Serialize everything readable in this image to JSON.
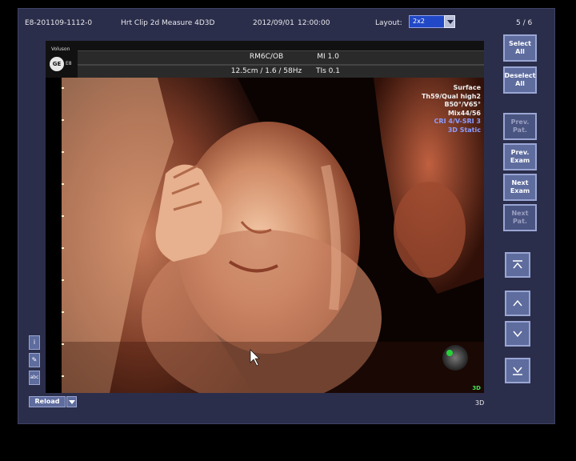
{
  "topbar": {
    "exam_id": "E8-201109-1112-0",
    "clip_title": "Hrt Clip 2d Measure 4D3D",
    "date": "2012/09/01",
    "time": "12:00:00",
    "layout_label": "Layout:",
    "layout_value": "2x2",
    "page": "5 / 6"
  },
  "viewer": {
    "brand": "Voluson",
    "model": "E8",
    "logo": "GE",
    "probe": "RM6C/OB",
    "depth_info": "12.5cm / 1.6 / 58Hz",
    "mi": "MI 1.0",
    "tis": "TIs 0.1",
    "params": [
      "Surface",
      "Th59/Qual high2",
      "B50°/V65°",
      "Mix44/56"
    ],
    "params_blue": [
      "CRI 4/V-SRI 3",
      "3D Static"
    ],
    "mode_tag": "3D"
  },
  "side_buttons": {
    "select_all": "Select All",
    "deselect_all": "Deselect All",
    "prev_pat": "Prev. Pat.",
    "prev_exam": "Prev. Exam",
    "next_exam": "Next Exam",
    "next_pat": "Next Pat."
  },
  "bottom": {
    "reload": "Reload",
    "mode": "3D"
  },
  "tools": [
    "i",
    "✎",
    "abc"
  ],
  "colors": {
    "panel": "#2b2e4a",
    "button": "#5e6c9e",
    "accent_blue": "#2148c6"
  }
}
